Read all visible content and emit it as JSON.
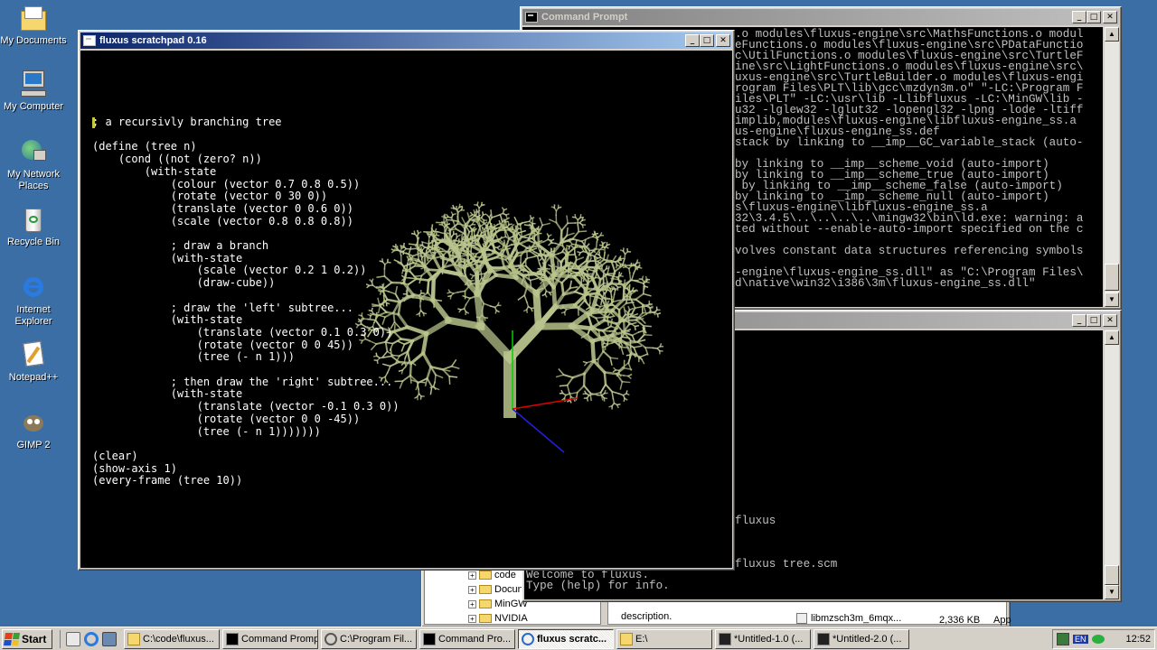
{
  "desktop_icons": [
    {
      "name": "my-documents",
      "label": "My Documents"
    },
    {
      "name": "my-computer",
      "label": "My Computer"
    },
    {
      "name": "my-network-places",
      "label": "My Network Places"
    },
    {
      "name": "recycle-bin",
      "label": "Recycle Bin"
    },
    {
      "name": "internet-explorer",
      "label": "Internet Explorer"
    },
    {
      "name": "notepad-plus-plus",
      "label": "Notepad++"
    },
    {
      "name": "gimp-2",
      "label": "GIMP 2"
    }
  ],
  "cmd_window": {
    "title": "Command Prompt",
    "lines": [
      ".o modules\\fluxus-engine\\src\\MathsFunctions.o modul",
      "eFunctions.o modules\\fluxus-engine\\src\\PDataFunctio",
      "c\\UtilFunctions.o modules\\fluxus-engine\\src\\TurtleF",
      "ine\\src\\LightFunctions.o modules\\fluxus-engine\\src\\",
      "uxus-engine\\src\\TurtleBuilder.o modules\\fluxus-engi",
      "rogram Files\\PLT\\lib\\gcc\\mzdyn3m.o\" \"-LC:\\Program F",
      "iles\\PLT\" -LC:\\usr\\lib -Llibfluxus -LC:\\MinGW\\lib -",
      "u32 -lglew32 -lglut32 -lopengl32 -lpng -lode -ltiff",
      "implib,modules\\fluxus-engine\\libfluxus-engine_ss.a",
      "us-engine\\fluxus-engine_ss.def",
      "stack by linking to __imp__GC_variable_stack (auto-",
      "",
      "by linking to __imp__scheme_void (auto-import)",
      "by linking to __imp__scheme_true (auto-import)",
      " by linking to __imp__scheme_false (auto-import)",
      "by linking to __imp__scheme_null (auto-import)",
      "s\\fluxus-engine\\libfluxus-engine_ss.a",
      "32\\3.4.5\\..\\..\\..\\..\\mingw32\\bin\\ld.exe: warning: a",
      "ted without --enable-auto-import specified on the c",
      "",
      "volves constant data structures referencing symbols",
      "",
      "-engine\\fluxus-engine_ss.dll\" as \"C:\\Program Files\\",
      "d\\native\\win32\\i386\\3m\\fluxus-engine_ss.dll\""
    ]
  },
  "cmd_window2": {
    "lines": [
      "fluxus",
      "",
      "",
      "",
      "fluxus tree.scm"
    ],
    "bottom_lines": [
      "Welcome to fluxus.",
      "Type (help) for info."
    ]
  },
  "explorer_partial": {
    "tree_items": [
      "code",
      "Docun",
      "MinGW",
      "NVIDIA"
    ],
    "file_desc": "description.",
    "file_name": "libmzsch3m_6mqx...",
    "file_size": "2,336 KB",
    "file_type": "App"
  },
  "fluxus_window": {
    "title": "fluxus scratchpad 0.16",
    "code_lines": [
      "; a recursivly branching tree",
      "",
      "(define (tree n)",
      "    (cond ((not (zero? n))",
      "        (with-state",
      "            (colour (vector 0.7 0.8 0.5))",
      "            (rotate (vector 0 30 0))",
      "            (translate (vector 0 0.6 0))",
      "            (scale (vector 0.8 0.8 0.8))",
      "",
      "            ; draw a branch",
      "            (with-state",
      "                (scale (vector 0.2 1 0.2))",
      "                (draw-cube))",
      "",
      "            ; draw the 'left' subtree...",
      "            (with-state",
      "                (translate (vector 0.1 0.3 0))",
      "                (rotate (vector 0 0 45))",
      "                (tree (- n 1)))",
      "",
      "            ; then draw the 'right' subtree...",
      "            (with-state",
      "                (translate (vector -0.1 0.3 0))",
      "                (rotate (vector 0 0 -45))",
      "                (tree (- n 1)))))))",
      "",
      "(clear)",
      "(show-axis 1)",
      "(every-frame (tree 10))"
    ],
    "tree_color": "#b8c48c"
  },
  "taskbar": {
    "start_label": "Start",
    "tasks": [
      {
        "name": "task-explorer-code-fluxus",
        "label": "C:\\code\\fluxus...",
        "pressed": false
      },
      {
        "name": "task-command-prompt-1",
        "label": "Command Prompt",
        "pressed": false
      },
      {
        "name": "task-explorer-program-files",
        "label": "C:\\Program Fil...",
        "pressed": false
      },
      {
        "name": "task-command-prompt-2",
        "label": "Command Pro...",
        "pressed": false
      },
      {
        "name": "task-fluxus-scratchpad",
        "label": "fluxus scratc...",
        "pressed": true
      },
      {
        "name": "task-explorer-e",
        "label": "E:\\",
        "pressed": false
      },
      {
        "name": "task-untitled-1",
        "label": "*Untitled-1.0 (...",
        "pressed": false
      },
      {
        "name": "task-untitled-2",
        "label": "*Untitled-2.0 (...",
        "pressed": false
      }
    ],
    "tray_lang": "EN",
    "clock": "12:52"
  }
}
